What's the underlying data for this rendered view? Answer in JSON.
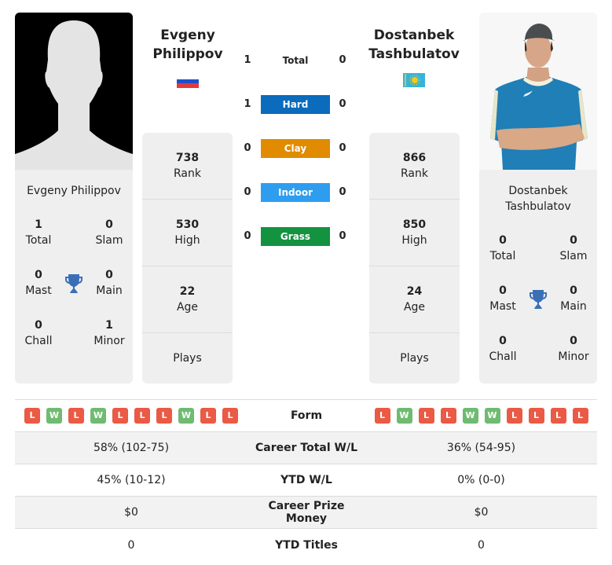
{
  "colors": {
    "hard": "#0b6bbd",
    "clay": "#e08b00",
    "indoor": "#2e9df0",
    "grass": "#139240",
    "loss": "#ea5a45",
    "win": "#6fbb72",
    "trophy": "#3a6fb8"
  },
  "player1": {
    "name_line1": "Evgeny",
    "name_line2": "Philippov",
    "card_name": "Evgeny Philippov",
    "country_flag": "russia-flag",
    "photo": "silhouette-placeholder",
    "titles": {
      "total": {
        "value": "1",
        "label": "Total"
      },
      "slam": {
        "value": "0",
        "label": "Slam"
      },
      "mast": {
        "value": "0",
        "label": "Mast"
      },
      "main": {
        "value": "0",
        "label": "Main"
      },
      "chall": {
        "value": "0",
        "label": "Chall"
      },
      "minor": {
        "value": "1",
        "label": "Minor"
      }
    },
    "stats": {
      "rank": {
        "value": "738",
        "label": "Rank"
      },
      "high": {
        "value": "530",
        "label": "High"
      },
      "age": {
        "value": "22",
        "label": "Age"
      },
      "plays": {
        "label": "Plays"
      }
    },
    "form": [
      "L",
      "W",
      "L",
      "W",
      "L",
      "L",
      "L",
      "W",
      "L",
      "L"
    ],
    "career_wl": "58% (102-75)",
    "ytd_wl": "45% (10-12)",
    "prize_money": "$0",
    "ytd_titles": "0"
  },
  "player2": {
    "name_line1": "Dostanbek",
    "name_line2": "Tashbulatov",
    "card_name_line1": "Dostanbek",
    "card_name_line2": "Tashbulatov",
    "country_flag": "kazakhstan-flag",
    "photo": "player-photo",
    "titles": {
      "total": {
        "value": "0",
        "label": "Total"
      },
      "slam": {
        "value": "0",
        "label": "Slam"
      },
      "mast": {
        "value": "0",
        "label": "Mast"
      },
      "main": {
        "value": "0",
        "label": "Main"
      },
      "chall": {
        "value": "0",
        "label": "Chall"
      },
      "minor": {
        "value": "0",
        "label": "Minor"
      }
    },
    "stats": {
      "rank": {
        "value": "866",
        "label": "Rank"
      },
      "high": {
        "value": "850",
        "label": "High"
      },
      "age": {
        "value": "24",
        "label": "Age"
      },
      "plays": {
        "label": "Plays"
      }
    },
    "form": [
      "L",
      "W",
      "L",
      "L",
      "W",
      "W",
      "L",
      "L",
      "L",
      "L"
    ],
    "career_wl": "36% (54-95)",
    "ytd_wl": "0% (0-0)",
    "prize_money": "$0",
    "ytd_titles": "0"
  },
  "h2h": {
    "surfaces": [
      {
        "label": "Total",
        "p1": "1",
        "p2": "0"
      },
      {
        "label": "Hard",
        "p1": "1",
        "p2": "0"
      },
      {
        "label": "Clay",
        "p1": "0",
        "p2": "0"
      },
      {
        "label": "Indoor",
        "p1": "0",
        "p2": "0"
      },
      {
        "label": "Grass",
        "p1": "0",
        "p2": "0"
      }
    ]
  },
  "compare": {
    "form_label": "Form",
    "career_wl_label": "Career Total W/L",
    "ytd_wl_label": "YTD W/L",
    "prize_label": "Career Prize Money",
    "ytd_titles_label": "YTD Titles"
  }
}
